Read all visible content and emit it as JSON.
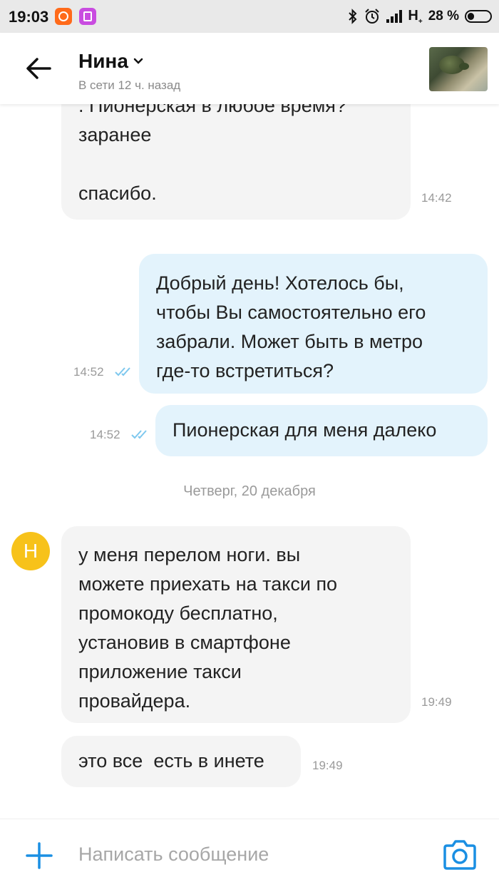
{
  "status_bar": {
    "time": "19:03",
    "network": "H",
    "network_sub": "+",
    "battery": "28 %",
    "icons": [
      "mi-app-icon",
      "gallery-app-icon",
      "bluetooth-icon",
      "alarm-icon",
      "signal-icon",
      "battery-icon"
    ]
  },
  "header": {
    "contact_name": "Нина",
    "status": "В сети 12 ч. назад"
  },
  "messages": [
    {
      "direction": "incoming",
      "text": ". Пионерская в любое время?\nзаранее\n\nспасибо.",
      "time": "14:42"
    },
    {
      "direction": "outgoing",
      "text": "Добрый день! Хотелось бы,\nчтобы Вы самостоятельно его\nзабрали. Может быть в метро\nгде-то встретиться?",
      "time": "14:52",
      "read": true
    },
    {
      "direction": "outgoing",
      "text": "Пионерская для меня далеко",
      "time": "14:52",
      "read": true
    }
  ],
  "date_separator": "Четверг, 20 декабря",
  "sender_avatar_letter": "Н",
  "messages_after": [
    {
      "direction": "incoming",
      "text": "у меня перелом ноги. вы\nможете приехать на такси по\nпромокоду бесплатно,\nустановив в смартфоне\nприложение такси\nпровайдера.",
      "time": "19:49"
    },
    {
      "direction": "incoming",
      "text": "это все  есть в инете",
      "time": "19:49"
    }
  ],
  "input": {
    "placeholder": "Написать сообщение",
    "value": ""
  },
  "colors": {
    "accent": "#1a8fe3",
    "incoming_bubble": "#f4f4f4",
    "outgoing_bubble": "#e3f3fc",
    "avatar": "#f7c21a",
    "read_check": "#7ec8ee"
  }
}
